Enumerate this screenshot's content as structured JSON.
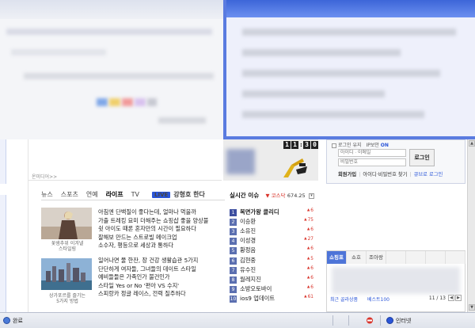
{
  "promo": {
    "clock": [
      "1",
      "1",
      ":",
      "3",
      "0"
    ],
    "banner_link": "온미디어>>"
  },
  "nav": {
    "tabs": [
      {
        "label": "뉴스",
        "active": false
      },
      {
        "label": "스포츠",
        "active": false
      },
      {
        "label": "연예",
        "active": false
      },
      {
        "label": "라이프",
        "active": true
      },
      {
        "label": "TV",
        "active": false
      }
    ],
    "live_badge": "LIVE",
    "live_text": "강형호 한다"
  },
  "news": {
    "thumbs": [
      {
        "caption_line1": "꽃샘추위 이겨낼",
        "caption_line2": "스타일링"
      },
      {
        "caption_line1": "상가포르를 즐기는",
        "caption_line2": "5가지 방법"
      }
    ],
    "group1": [
      "아침엔 단백질이 좋다는데, 얼마나 먹을까",
      "가출 트레킹 묘미 더해주는 쇼핑샵 좋을 양상불",
      "쉿 아이도 때론 혼자만의 시간이 필요하다",
      "잘해보 만드는 스트로빌 메이크업",
      "소수자, 평등으로 세상과 통하다"
    ],
    "group2": [
      "일어나면 물 한잔, 장 건강 생활습관 5가지",
      "단단하게 여자들, 그녀들의 데이트 스타일",
      "예비들들은 가족인가 불건인가",
      "스타일 Yes or No '편아 VS 수지'",
      "스피랑카 정글 레이스, 전력 질주하다"
    ]
  },
  "issues": {
    "title": "실시간 이슈",
    "kospi_label": "▼ 코스닥",
    "kospi_value": "674.25",
    "items": [
      {
        "rank": "1",
        "name": "복면가왕 클리디",
        "value": "6",
        "bold": true
      },
      {
        "rank": "2",
        "name": "이승환",
        "value": "75",
        "bold": false
      },
      {
        "rank": "3",
        "name": "소유진",
        "value": "6",
        "bold": false
      },
      {
        "rank": "4",
        "name": "이성경",
        "value": "27",
        "bold": false
      },
      {
        "rank": "5",
        "name": "황정음",
        "value": "6",
        "bold": false
      },
      {
        "rank": "6",
        "name": "김현중",
        "value": "5",
        "bold": false
      },
      {
        "rank": "7",
        "name": "유수진",
        "value": "6",
        "bold": false
      },
      {
        "rank": "8",
        "name": "월레지진",
        "value": "6",
        "bold": false
      },
      {
        "rank": "9",
        "name": "소방오토바이",
        "value": "6",
        "bold": false
      },
      {
        "rank": "10",
        "name": "ios9 업데이트",
        "value": "61",
        "bold": false
      }
    ]
  },
  "login": {
    "keep_login": "로그인 유지",
    "ip_security": "IP보안",
    "ip_on": "ON",
    "id_placeholder": "아이디 · 이메일",
    "pw_placeholder": "비밀번호",
    "button": "로그인",
    "signup": "회원가입",
    "find": "아이디·비밀번호 찾기",
    "qr": "큐브로 로그인"
  },
  "tabs": {
    "items": [
      {
        "label": "쇼핑표",
        "active": true
      },
      {
        "label": "쇼호",
        "active": false
      },
      {
        "label": "조아랑",
        "active": false
      },
      {
        "label": "",
        "active": false
      },
      {
        "label": "",
        "active": false
      },
      {
        "label": "",
        "active": false
      },
      {
        "label": "",
        "active": false
      }
    ],
    "footer_left": "최근 골라상품",
    "footer_mid": "베스트100",
    "page": "11 / 13",
    "prev": "◀",
    "next": "▶"
  },
  "status": {
    "left": "완료",
    "zone": "인터넷"
  }
}
